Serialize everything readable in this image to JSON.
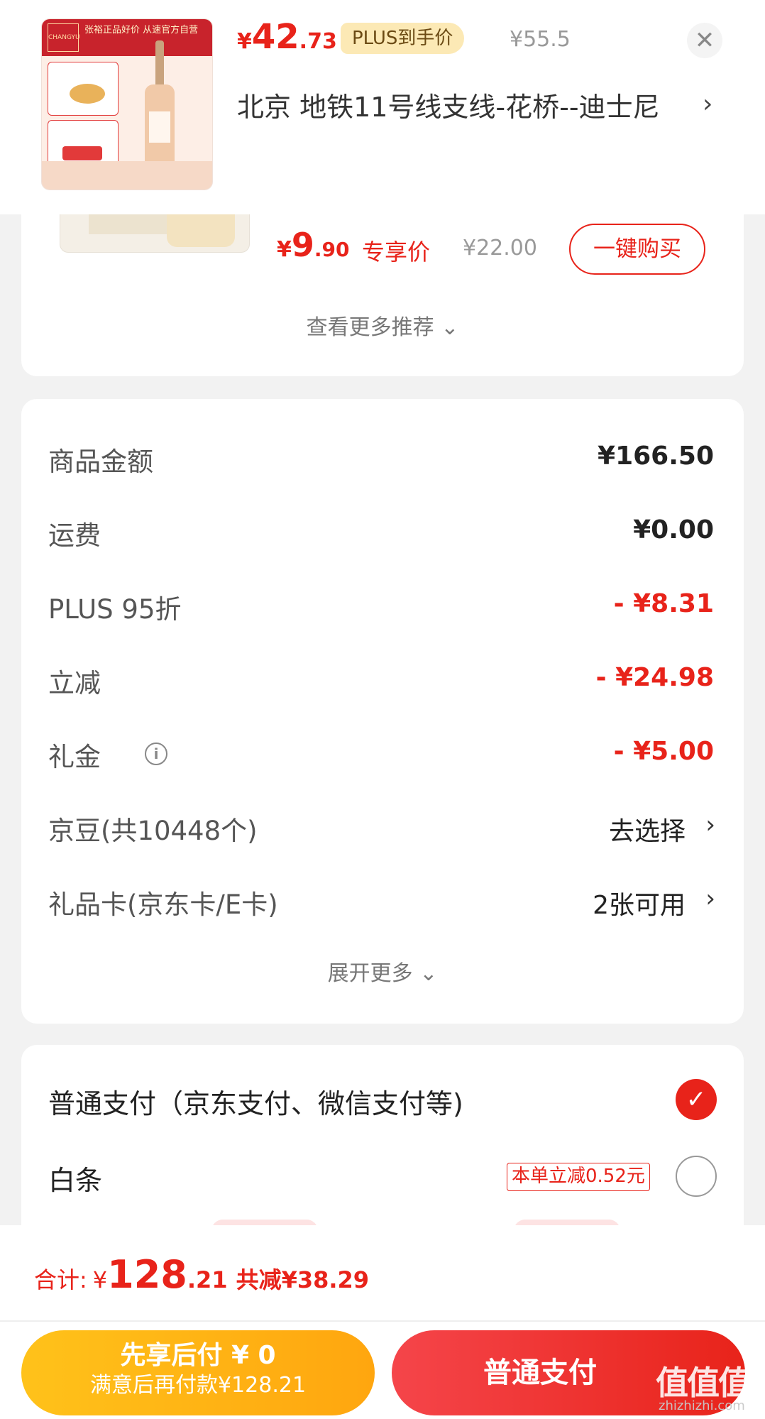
{
  "header": {
    "price": {
      "symbol": "¥",
      "integer": "42",
      "decimal": ".73"
    },
    "plus_badge": "PLUS到手价",
    "original_price": "¥55.5",
    "close_label": "✕",
    "address": "北京  地铁11号线支线-花桥--迪士尼",
    "address_chevron": "›",
    "thumb_text": "张裕正品好价 从速官方自营"
  },
  "recommendation": {
    "price": {
      "symbol": "¥",
      "integer": "9",
      "decimal": ".90"
    },
    "tag": "专享价",
    "original_price": "¥22.00",
    "buy_label": "一键购买",
    "more_label": "查看更多推荐 ⌄"
  },
  "cost": {
    "rows": [
      {
        "label": "商品金额",
        "value": "¥166.50"
      },
      {
        "label": "运费",
        "value": "¥0.00"
      },
      {
        "label": "PLUS 95折",
        "value": "- ¥8.31"
      },
      {
        "label": "立减",
        "value": "- ¥24.98"
      },
      {
        "label": "礼金",
        "value": "- ¥5.00"
      },
      {
        "label": "京豆(共10448个)",
        "value": "去选择"
      },
      {
        "label": "礼品卡(京东卡/E卡)",
        "value": "2张可用"
      }
    ],
    "info_icon": "i",
    "chevron": "›",
    "expand_label": "展开更多 ⌄"
  },
  "payment": {
    "normal_label": "普通支付（京东支付、微信支付等)",
    "normal_checked_icon": "✓",
    "baitiao_label": "白条",
    "baitiao_tag": "本单立减0.52元"
  },
  "footer": {
    "total_label": "合计:",
    "total_price": {
      "symbol": "¥",
      "integer": "128",
      "decimal": ".21"
    },
    "saved": "共减¥38.29",
    "later_line1": "先享后付 ¥ 0",
    "later_line2": "满意后再付款¥128.21",
    "pay_label": "普通支付",
    "watermark": "值值值",
    "watermark_url": "zhizhizhi.com"
  },
  "colors": {
    "accent": "#e8231a",
    "gold": "#ffb515",
    "plus_badge_bg": "#fce9b5"
  }
}
